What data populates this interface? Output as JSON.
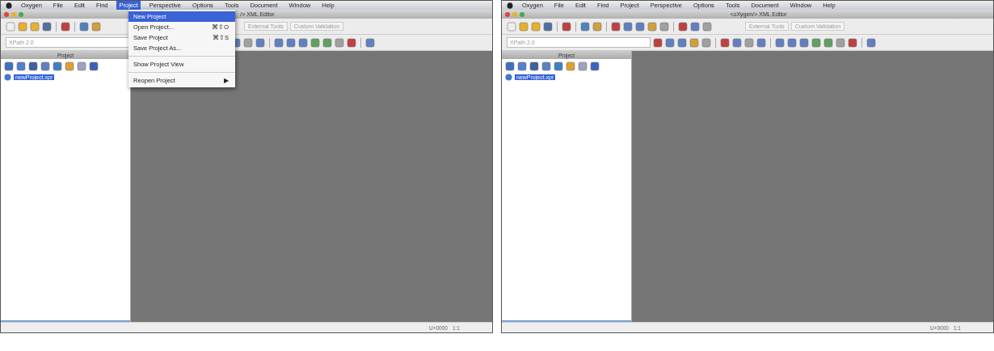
{
  "screens": [
    {
      "menubar": [
        {
          "label": "Oxygen",
          "selected": false
        },
        {
          "label": "File",
          "selected": false
        },
        {
          "label": "Edit",
          "selected": false
        },
        {
          "label": "Find",
          "selected": false
        },
        {
          "label": "Project",
          "selected": true
        },
        {
          "label": "Perspective",
          "selected": false
        },
        {
          "label": "Options",
          "selected": false
        },
        {
          "label": "Tools",
          "selected": false
        },
        {
          "label": "Document",
          "selected": false
        },
        {
          "label": "Window",
          "selected": false
        },
        {
          "label": "Help",
          "selected": false
        }
      ],
      "window": {
        "title": "/> XML Editor"
      },
      "toolbar": {
        "dropdowns": [
          "External Tools",
          "Custom Validation"
        ],
        "xpath": "XPath 2.0"
      },
      "project_panel": {
        "title": "Project",
        "items": [
          {
            "label": "newProject.xpr",
            "selected": true
          }
        ]
      },
      "status_bar": [
        "U+0000",
        "1:1"
      ],
      "menu": {
        "items": [
          {
            "kind": "item",
            "label": "New Project",
            "selected": true
          },
          {
            "kind": "item",
            "label": "Open Project...",
            "shortcut": "⌘⇧O",
            "selected": false
          },
          {
            "kind": "item",
            "label": "Save Project",
            "shortcut": "⌘⇧S",
            "selected": false
          },
          {
            "kind": "item",
            "label": "Save Project As...",
            "selected": false
          },
          {
            "kind": "separator"
          },
          {
            "kind": "item",
            "label": "Show Project View",
            "selected": false
          },
          {
            "kind": "separator"
          },
          {
            "kind": "submenu",
            "label": "Reopen Project",
            "arrow": "▶",
            "selected": false
          }
        ]
      }
    },
    {
      "menubar": [
        {
          "label": "Oxygen",
          "selected": false
        },
        {
          "label": "File",
          "selected": false
        },
        {
          "label": "Edit",
          "selected": false
        },
        {
          "label": "Find",
          "selected": false
        },
        {
          "label": "Project",
          "selected": false
        },
        {
          "label": "Perspective",
          "selected": false
        },
        {
          "label": "Options",
          "selected": false
        },
        {
          "label": "Tools",
          "selected": false
        },
        {
          "label": "Document",
          "selected": false
        },
        {
          "label": "Window",
          "selected": false
        },
        {
          "label": "Help",
          "selected": false
        }
      ],
      "window": {
        "title": "<oXygen/> XML Editor"
      },
      "toolbar": {
        "dropdowns": [
          "External Tools",
          "Custom Validation"
        ],
        "xpath": "XPath 2.0"
      },
      "project_panel": {
        "title": "Project",
        "items": [
          {
            "label": "newProject.xpr",
            "selected": true
          }
        ]
      },
      "status_bar": [
        "U+0000",
        "1:1"
      ]
    }
  ]
}
